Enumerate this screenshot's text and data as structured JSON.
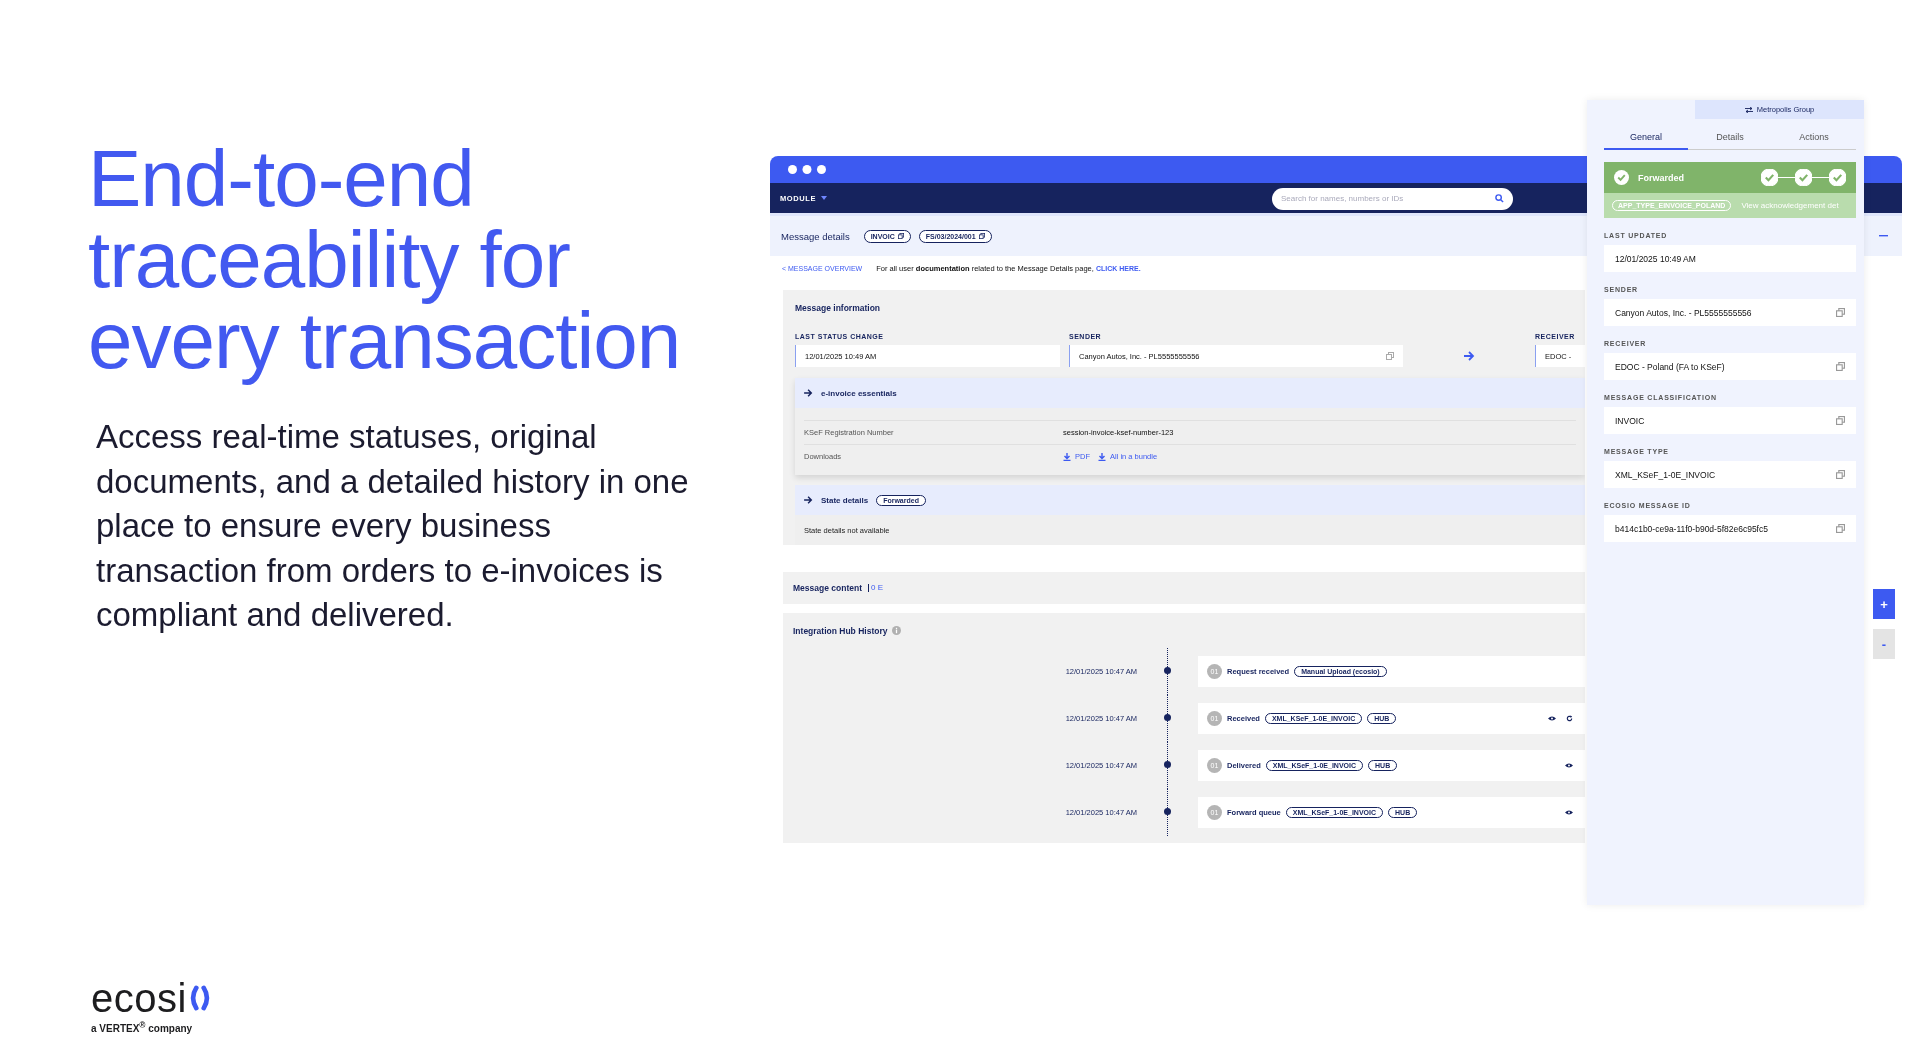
{
  "hero": {
    "title": "End-to-end traceability for every transaction",
    "text": "Access real-time statuses, original documents, and a detailed history in one place to ensure every business transaction from orders to e-invoices is compliant and delivered."
  },
  "logo": {
    "wordmark": "ecosi",
    "tagline": "a VERTEX$^{®}$ company"
  },
  "app": {
    "nav": {
      "module": "MODULE",
      "search_placeholder": "Search for names, numbers or IDs"
    },
    "header": {
      "title": "Message details",
      "chips": [
        "INVOIC",
        "FS/03/2024/001"
      ]
    },
    "back_link": "< MESSAGE OVERVIEW",
    "notice": {
      "text": "For all user **documentation** related to the Message Details page,",
      "link": "CLICK HERE."
    },
    "message_information": {
      "title": "Message information",
      "fields": [
        {
          "label": "LAST STATUS CHANGE",
          "value": "12/01/2025 10:49 AM",
          "copy": false
        },
        {
          "label": "SENDER",
          "value": "Canyon Autos, Inc. - PL5555555556",
          "copy": true
        },
        {
          "label": "RECEIVER",
          "value": "EDOC -",
          "copy": false
        }
      ]
    },
    "essentials": {
      "title": "e-invoice essentials",
      "rows": [
        {
          "label": "KSeF Registration Number",
          "value": "session-invoice-ksef-number-123"
        }
      ],
      "downloads": {
        "label": "Downloads",
        "links": [
          "PDF",
          "All in a bundle"
        ]
      }
    },
    "state_details": {
      "title": "State details",
      "badge": "Forwarded",
      "text": "State details not available"
    },
    "message_content": {
      "title": "Message content",
      "count": "0 E"
    },
    "history": {
      "title": "Integration Hub History",
      "events": [
        {
          "time": "12/01/2025 10:47 AM",
          "step": "01",
          "name": "Request received",
          "tags": [
            "Manual Upload (ecosio)"
          ],
          "viewable": false,
          "retryable": false
        },
        {
          "time": "12/01/2025 10:47 AM",
          "step": "01",
          "name": "Received",
          "tags": [
            "XML_KSeF_1-0E_INVOIC",
            "HUB"
          ],
          "viewable": true,
          "retryable": true
        },
        {
          "time": "12/01/2025 10:47 AM",
          "step": "01",
          "name": "Delivered",
          "tags": [
            "XML_KSeF_1-0E_INVOIC",
            "HUB"
          ],
          "viewable": true,
          "retryable": false
        },
        {
          "time": "12/01/2025 10:47 AM",
          "step": "01",
          "name": "Forward queue",
          "tags": [
            "XML_KSeF_1-0E_INVOIC",
            "HUB"
          ],
          "viewable": true,
          "retryable": false
        }
      ]
    },
    "zoom_controls": [
      {
        "label": "+",
        "kind": "add"
      },
      {
        "label": "-",
        "kind": "remove"
      }
    ]
  },
  "panel": {
    "group": "Metropolis Group",
    "tabs": [
      {
        "label": "General",
        "selected": true
      },
      {
        "label": "Details",
        "selected": false
      },
      {
        "label": "Actions",
        "selected": false
      }
    ],
    "status": {
      "label": "Forwarded",
      "steps": [
        {
          "done": true
        },
        {
          "done": true
        },
        {
          "done": true
        }
      ]
    },
    "app_type": "APP_TYPE_EINVOICE_POLAND",
    "ack_link": "View acknowledgement det",
    "fields": [
      {
        "label": "LAST UPDATED",
        "value": "12/01/2025 10:49 AM",
        "copy": false
      },
      {
        "label": "SENDER",
        "value": "Canyon Autos, Inc. - PL5555555556",
        "copy": true
      },
      {
        "label": "RECEIVER",
        "value": "EDOC - Poland (FA to KSeF)",
        "copy": true
      },
      {
        "label": "MESSAGE CLASSIFICATION",
        "value": "INVOIC",
        "copy": true
      },
      {
        "label": "MESSAGE TYPE",
        "value": "XML_KSeF_1-0E_INVOIC",
        "copy": true
      },
      {
        "label": "ECOSIO MESSAGE ID",
        "value": "b414c1b0-ce9a-11f0-b90d-5f82e6c95fc5",
        "copy": true
      }
    ]
  }
}
